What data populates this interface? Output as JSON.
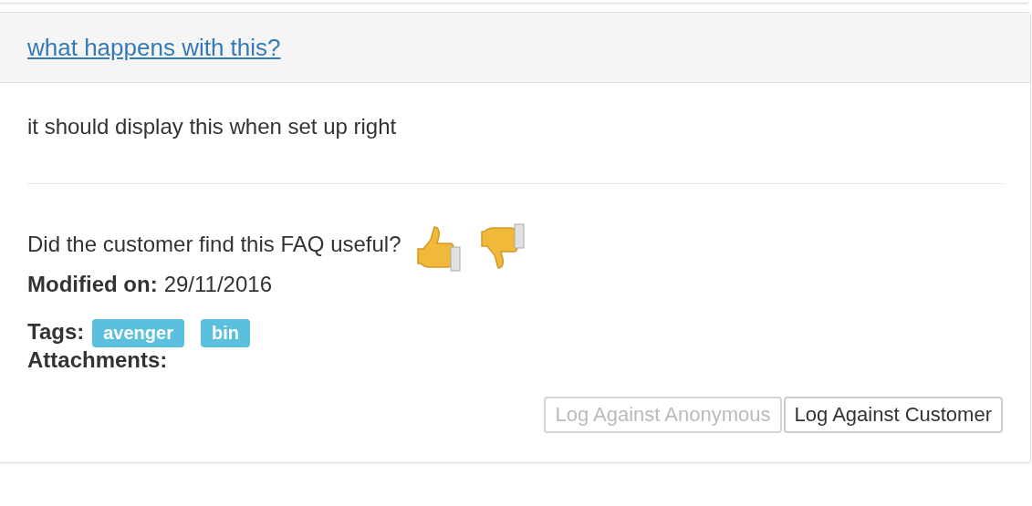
{
  "faq": {
    "title": "what happens with this?",
    "answer": "it should display this when set up right",
    "question": "Did the customer find this FAQ useful?",
    "modified_label": "Modified on:",
    "modified_value": "29/11/2016",
    "tags_label": "Tags:",
    "tags": [
      "avenger",
      "bin"
    ],
    "attachments_label": "Attachments:"
  },
  "buttons": [
    {
      "label": "Log Against Anonymous",
      "disabled": true
    },
    {
      "label": "Log Against Customer",
      "disabled": false
    }
  ]
}
